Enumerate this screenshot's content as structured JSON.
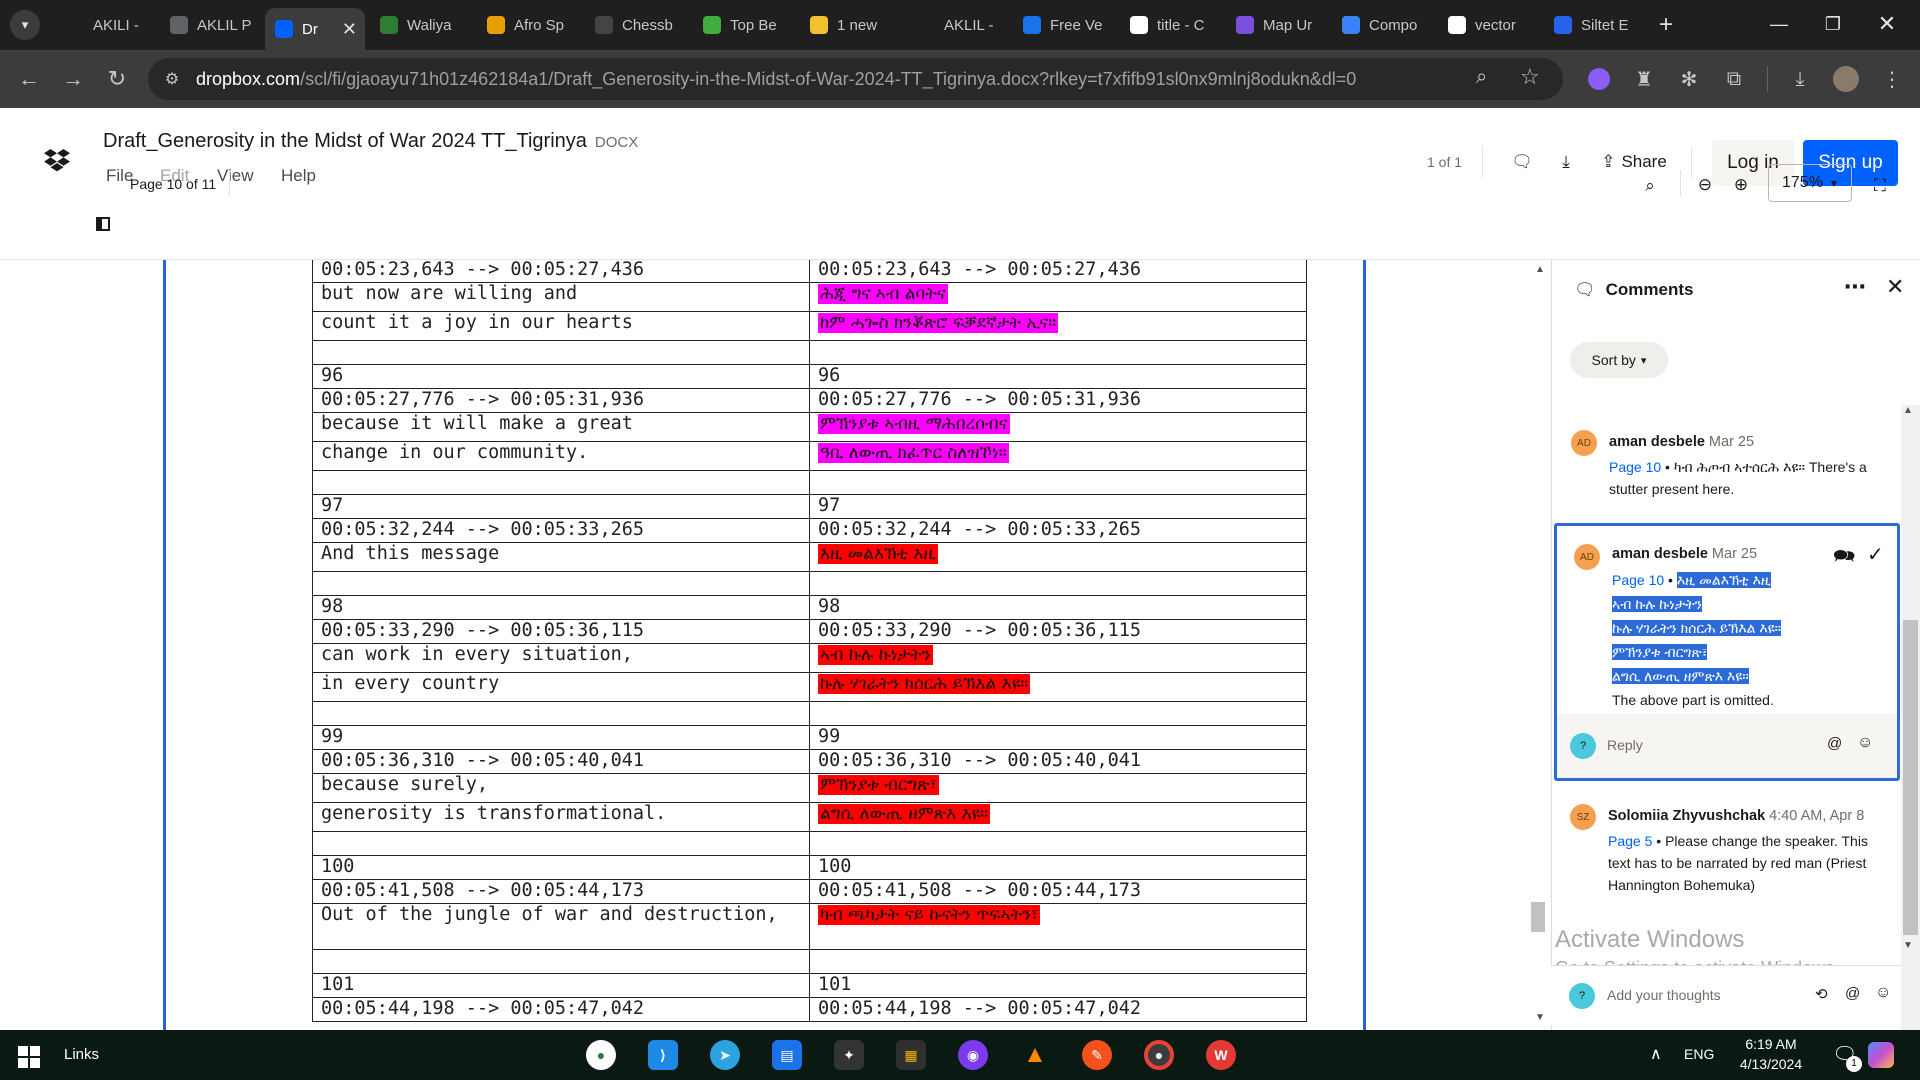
{
  "browser": {
    "tabs": [
      {
        "label": "AKILI -",
        "icon": "akili-icon",
        "color": "#1f1f1f"
      },
      {
        "label": "AKLIL P",
        "icon": "globe-icon",
        "color": "#5f6368"
      },
      {
        "label": "Dr",
        "icon": "dropbox-icon",
        "color": "#0061fe",
        "active": true
      },
      {
        "label": "Waliya",
        "icon": "waliya-icon",
        "color": "#2e7d32"
      },
      {
        "label": "Afro Sp",
        "icon": "afro-icon",
        "color": "#e6a100"
      },
      {
        "label": "Chessb",
        "icon": "chess-icon",
        "color": "#444"
      },
      {
        "label": "Top Be",
        "icon": "top-icon",
        "color": "#3fae3f"
      },
      {
        "label": "1 new",
        "icon": "emoji-icon",
        "color": "#f2c12e"
      },
      {
        "label": "AKLIL -",
        "icon": "aklil-icon",
        "color": "#1f1f1f"
      },
      {
        "label": "Free Ve",
        "icon": "docs-icon",
        "color": "#1a73e8"
      },
      {
        "label": "title - C",
        "icon": "google-icon",
        "color": "#fff"
      },
      {
        "label": "Map Ur",
        "icon": "map-icon",
        "color": "#7b4fe0"
      },
      {
        "label": "Compo",
        "icon": "compo-icon",
        "color": "#3b82f6"
      },
      {
        "label": "vector",
        "icon": "google-icon",
        "color": "#fff"
      },
      {
        "label": "Siltet E",
        "icon": "siltet-icon",
        "color": "#2563eb"
      }
    ],
    "url_domain": "dropbox.com",
    "url_rest": "/scl/fi/gjaoayu71h01z462184a1/Draft_Generosity-in-the-Midst-of-War-2024-TT_Tigrinya.docx?rlkey=t7xfifb91sl0nx9mlnj8odukn&dl=0"
  },
  "header": {
    "doc_title": "Draft_Generosity in the Midst of War 2024 TT_Tigrinya",
    "doc_type": "DOCX",
    "menu": [
      "File",
      "Edit",
      "View",
      "Help"
    ],
    "page_count": "1 of 1",
    "share": "Share",
    "login": "Log in",
    "signup": "Sign up",
    "page_indicator": "Page 10 of 11",
    "zoom": "175%"
  },
  "subtitles": [
    {
      "type": "row",
      "en": "00:05:23,643 --> 00:05:27,436",
      "ti": "00:05:23,643 --> 00:05:27,436"
    },
    {
      "type": "line",
      "en": "but now are willing and",
      "ti": "ሕጂ ግና ኣብ ልባትና",
      "hl": "mag"
    },
    {
      "type": "line",
      "en": "count it a joy in our hearts",
      "ti": "ከም ሓጐስ ክንቖጽሮ ፍቓደኛታት ኢና።",
      "hl": "mag"
    },
    {
      "type": "blank"
    },
    {
      "type": "row",
      "en": "96",
      "ti": "96"
    },
    {
      "type": "row",
      "en": "00:05:27,776 --> 00:05:31,936",
      "ti": "00:05:27,776 --> 00:05:31,936"
    },
    {
      "type": "line",
      "en": "because it will make a great",
      "ti": "ምኽንያቱ ኣብዚ ማሕበረሰብና",
      "hl": "mag"
    },
    {
      "type": "line",
      "en": "change in our community.",
      "ti": "ዓቢ ለውጢ ክፈጥር ስለዝኾነ።",
      "hl": "mag"
    },
    {
      "type": "blank"
    },
    {
      "type": "row",
      "en": "97",
      "ti": "97"
    },
    {
      "type": "row",
      "en": "00:05:32,244 --> 00:05:33,265",
      "ti": "00:05:32,244 --> 00:05:33,265"
    },
    {
      "type": "line",
      "en": "And this message",
      "ti": "እዚ መልእኽቲ እዚ",
      "hl": "red"
    },
    {
      "type": "blank"
    },
    {
      "type": "row",
      "en": "98",
      "ti": "98"
    },
    {
      "type": "row",
      "en": "00:05:33,290 --> 00:05:36,115",
      "ti": "00:05:33,290 --> 00:05:36,115"
    },
    {
      "type": "line",
      "en": "can work in every situation,",
      "ti": "ኣብ ኩሉ ኩነታትን",
      "hl": "red"
    },
    {
      "type": "line",
      "en": "in every country",
      "ti": "ኩሉ ሃገራትን ክሰርሕ ይኽእል እዩ።",
      "hl": "red"
    },
    {
      "type": "blank"
    },
    {
      "type": "row",
      "en": "99",
      "ti": "99"
    },
    {
      "type": "row",
      "en": "00:05:36,310 --> 00:05:40,041",
      "ti": "00:05:36,310 --> 00:05:40,041"
    },
    {
      "type": "line",
      "en": "because surely,",
      "ti": "ምኽንያቱ ብርግጽ፣",
      "hl": "red"
    },
    {
      "type": "line",
      "en": "generosity is transformational.",
      "ti": "ልግሲ ለውጢ ዘምጽእ እዩ።",
      "hl": "red"
    },
    {
      "type": "blank"
    },
    {
      "type": "row",
      "en": "100",
      "ti": "100"
    },
    {
      "type": "row",
      "en": "00:05:41,508 --> 00:05:44,173",
      "ti": "00:05:41,508 --> 00:05:44,173"
    },
    {
      "type": "dbl",
      "en": "Out of the jungle of war and destruction,",
      "ti": "ካብ ጫካታት ናይ ኩናትን ጥፍኣትን፣",
      "hl": "red"
    },
    {
      "type": "blank"
    },
    {
      "type": "row",
      "en": "101",
      "ti": "101"
    },
    {
      "type": "row",
      "en": "00:05:44,198 --> 00:05:47,042",
      "ti": "00:05:44,198 --> 00:05:47,042"
    }
  ],
  "comments_panel": {
    "title": "Comments",
    "sort_label": "Sort by",
    "comments": [
      {
        "initials": "AD",
        "author": "aman desbele",
        "date": "Mar 25",
        "page": "Page 10",
        "quote": "ካብ ሕጦብ ኣተሰርሕ እዩ።",
        "text": "There's a stutter present here."
      },
      {
        "initials": "AD",
        "author": "aman desbele",
        "date": "Mar 25",
        "page": "Page 10",
        "quote_lines": [
          "እዚ መልእኽቲ እዚ",
          "ኣብ ኩሉ ኩነታትን",
          "ኩሉ ሃገራትን ክሰርሕ ይኽእል እዩ።",
          "ምኽንያቱ ብርግጽ፣",
          "ልግሲ ለውጢ ዘምጽእ እዩ።"
        ],
        "text": "The above part is omitted."
      },
      {
        "initials": "SZ",
        "author": "Solomiia Zhyvushchak",
        "date": "4:40 AM, Apr 8",
        "page": "Page 5",
        "text": "Please change the speaker. This text has to be narrated by red man (Priest Hannington Bohemuka)"
      }
    ],
    "reply_placeholder": "Reply",
    "add_placeholder": "Add your thoughts"
  },
  "watermark": {
    "title": "Activate Windows",
    "subtitle": "Go to Settings to activate Windows."
  },
  "taskbar": {
    "links_label": "Links",
    "language": "ENG",
    "time": "6:19 AM",
    "date": "4/13/2024",
    "notification_count": "1"
  }
}
